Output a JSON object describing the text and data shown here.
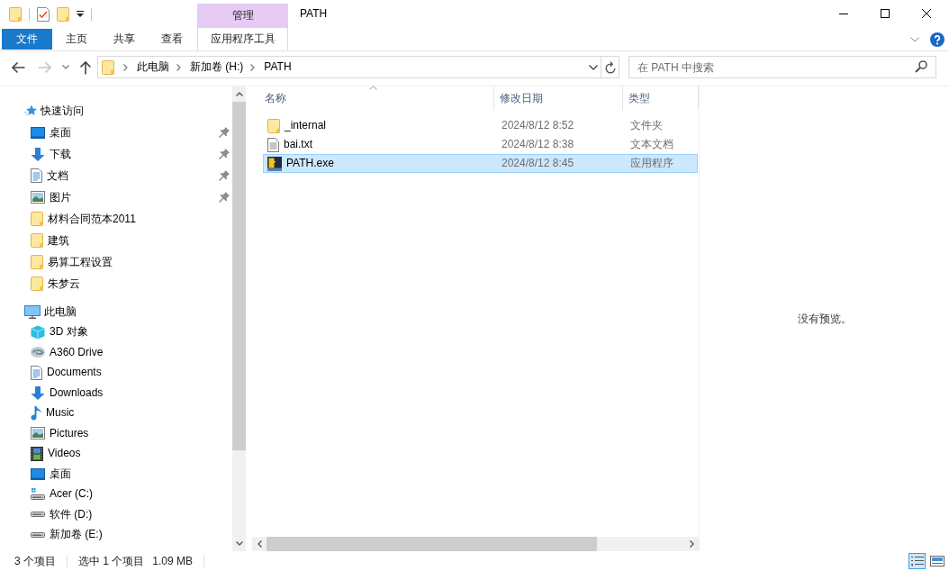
{
  "title_bar": {
    "context_group": "管理",
    "title": "PATH"
  },
  "ribbon": {
    "tabs": [
      {
        "kind": "file",
        "label": "文件",
        "selected": false
      },
      {
        "kind": "tab",
        "label": "主页",
        "selected": false
      },
      {
        "kind": "tab",
        "label": "共享",
        "selected": false
      },
      {
        "kind": "tab",
        "label": "查看",
        "selected": false
      },
      {
        "kind": "context",
        "label": "应用程序工具",
        "selected": false
      }
    ]
  },
  "nav_buttons": [
    {
      "kind": "back",
      "disabled": false
    },
    {
      "kind": "forward",
      "disabled": true
    },
    {
      "kind": "recent",
      "disabled": false
    },
    {
      "kind": "up",
      "disabled": false
    }
  ],
  "address_bar": {
    "crumbs": [
      "此电脑",
      "新加卷 (H:)",
      "PATH"
    ]
  },
  "search": {
    "placeholder": "在 PATH 中搜索"
  },
  "sidebar": {
    "items": [
      {
        "kind": "quick",
        "label": "快速访问",
        "children": [
          {
            "kind": "desktop",
            "label": "桌面",
            "pinned": true
          },
          {
            "kind": "downloads",
            "label": "下载",
            "pinned": true
          },
          {
            "kind": "documents",
            "label": "文档",
            "pinned": true
          },
          {
            "kind": "pictures",
            "label": "图片",
            "pinned": true
          },
          {
            "kind": "folder",
            "label": "材料合同范本2011",
            "pinned": false
          },
          {
            "kind": "folder",
            "label": "建筑",
            "pinned": false
          },
          {
            "kind": "folder",
            "label": "易算工程设置",
            "pinned": false
          },
          {
            "kind": "folder",
            "label": "朱梦云",
            "pinned": false
          }
        ]
      },
      {
        "kind": "pc",
        "label": "此电脑",
        "children": [
          {
            "kind": "objects3d",
            "label": "3D 对象"
          },
          {
            "kind": "a360",
            "label": "A360 Drive"
          },
          {
            "kind": "documents",
            "label": "Documents"
          },
          {
            "kind": "downloads",
            "label": "Downloads"
          },
          {
            "kind": "music",
            "label": "Music"
          },
          {
            "kind": "pictures",
            "label": "Pictures"
          },
          {
            "kind": "videos",
            "label": "Videos"
          },
          {
            "kind": "desktop",
            "label": "桌面"
          },
          {
            "kind": "drive_system",
            "label": "Acer (C:)"
          },
          {
            "kind": "drive",
            "label": "软件 (D:)"
          },
          {
            "kind": "drive",
            "label": "新加卷 (E:)"
          }
        ]
      }
    ]
  },
  "file_list": {
    "columns": [
      {
        "label": "名称",
        "sorted": true
      },
      {
        "label": "修改日期",
        "sorted": false
      },
      {
        "label": "类型",
        "sorted": false
      }
    ],
    "rows": [
      {
        "kind": "folder",
        "name": "_internal",
        "modified": "2024/8/12 8:52",
        "type": "文件夹",
        "selected": false
      },
      {
        "kind": "text",
        "name": "bai.txt",
        "modified": "2024/8/12 8:38",
        "type": "文本文档",
        "selected": false
      },
      {
        "kind": "app",
        "name": "PATH.exe",
        "modified": "2024/8/12 8:45",
        "type": "应用程序",
        "selected": true
      }
    ]
  },
  "preview": {
    "message": "没有预览。"
  },
  "status_bar": {
    "item_count": "3 个项目",
    "selection": "选中 1 个项目",
    "size": "1.09 MB",
    "views": [
      {
        "kind": "details",
        "selected": true
      },
      {
        "kind": "thumbnails",
        "selected": false
      }
    ]
  }
}
